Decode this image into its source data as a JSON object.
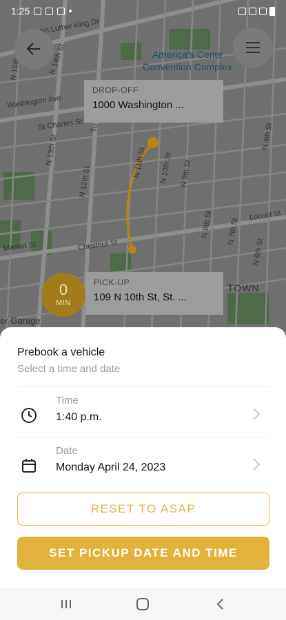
{
  "status": {
    "time": "1:25"
  },
  "map": {
    "place_label": [
      "America's Cente",
      "Convention Complex"
    ],
    "streets": {
      "mlk": "Martin Luther King Dr",
      "washington": "Washington Ave",
      "st_charles": "St Charles St",
      "chestnut": "Chestnut St",
      "market": "Market St",
      "locust": "Locust St",
      "n14": "N 14th St",
      "n13": "N 13th St",
      "n12": "N 12th St",
      "n11": "N 11th St",
      "n10": "N 10th St",
      "n9": "N 9th St",
      "n8": "N 8th St",
      "n7": "N 7th St",
      "n6": "N 6th St",
      "n15": "N 15th St",
      "n4": "N 4th St",
      "tu": "Tu",
      "town": "TOWN",
      "garage": "er Garage"
    }
  },
  "dropoff": {
    "caption": "DROP-OFF",
    "address": "1000 Washington ..."
  },
  "pickup": {
    "caption": "PICK-UP",
    "address": "109 N 10th St, St. ..."
  },
  "eta": {
    "value": "0",
    "unit": "MIN"
  },
  "sheet": {
    "title": "Prebook a vehicle",
    "subtitle": "Select a time and date",
    "time": {
      "caption": "Time",
      "value": "1:40 p.m."
    },
    "date": {
      "caption": "Date",
      "value": "Monday April 24, 2023"
    },
    "reset_label": "RESET TO ASAP",
    "confirm_label": "SET PICKUP DATE AND TIME"
  },
  "colors": {
    "accent": "#e3b23c",
    "route": "#b8860b"
  }
}
